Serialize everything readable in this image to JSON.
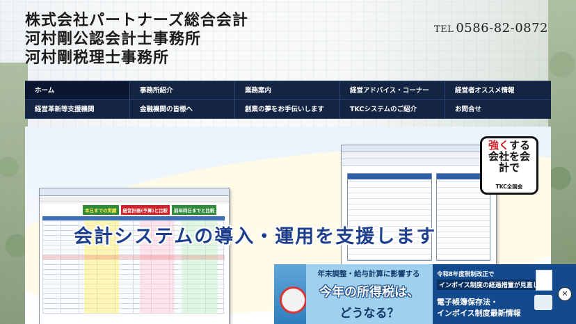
{
  "header": {
    "names": [
      "株式会社パートナーズ総合会計",
      "河村剛公認会計士事務所",
      "河村剛税理士事務所"
    ],
    "tel_label": "TEL",
    "tel_number": "0586-82-0872"
  },
  "nav": {
    "row1": [
      "ホーム",
      "事務所紹介",
      "業務案内",
      "経営アドバイス・コーナー",
      "経営者オススメ情報"
    ],
    "row2": [
      "経営革新等支援機関",
      "金融機関の皆様へ",
      "創業の夢をお手伝いします",
      "TKCシステムのご紹介",
      "お問合せ"
    ]
  },
  "hero": {
    "slogan": "会計システムの導入・運用を支援します",
    "badge_lines": [
      "強く",
      "する",
      "会社を",
      "会計で"
    ],
    "badge_org": "TKC全国会",
    "screen1_tags": [
      "本日までの実績",
      "経営計画(予算)と比較",
      "前年同日までと比較"
    ]
  },
  "ad": {
    "mid_line1": "年末調整・給与計算に影響する",
    "mid_line2": "今年の所得税は、",
    "mid_line3": "どうなる？",
    "right_line1": "令和8年度税制改正で",
    "right_line2": "インボイス制度の経過措置が見直し",
    "right_line3": "電子帳簿保存法・",
    "right_line4": "インボイス制度最新情報",
    "close": "✕"
  }
}
